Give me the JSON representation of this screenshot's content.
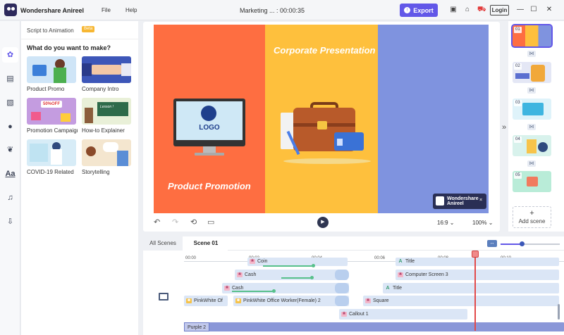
{
  "app": {
    "title": "Wondershare Anireel",
    "menu": [
      "File",
      "Help"
    ],
    "document_title": "Marketing ... : 00:00:35",
    "export_label": "Export",
    "login_label": "Login"
  },
  "left_panel": {
    "header": "Script to Animation",
    "header_badge": "Beta",
    "question": "What do you want to make?",
    "templates": [
      {
        "label": "Product Promo"
      },
      {
        "label": "Company Intro"
      },
      {
        "label": "Promotion Campaign"
      },
      {
        "label": "How-to Explainer"
      },
      {
        "label": "COVID-19 Related"
      },
      {
        "label": "Storytelling"
      }
    ],
    "thumb_texts": {
      "promo_ribbon": "50%OFF",
      "lesson": "Lesson !"
    }
  },
  "canvas": {
    "slide_text_1": "Corporate Presentation",
    "slide_text_2": "Product Promotion",
    "monitor_logo": "LOGO",
    "watermark_line1": "Wondershare",
    "watermark_line2": "Anireel",
    "watermark_close": "×",
    "aspect_ratio": "16:9",
    "zoom_level": "100%",
    "colors": {
      "orange": "#fe6e41",
      "yellow": "#fec03d",
      "blue": "#7f93df",
      "accent": "#6257e8"
    }
  },
  "scenes_panel": {
    "scenes": [
      {
        "num": "01"
      },
      {
        "num": "02"
      },
      {
        "num": "03"
      },
      {
        "num": "04"
      },
      {
        "num": "05"
      }
    ],
    "add_scene_label": "Add scene"
  },
  "timeline": {
    "tabs": [
      "All Scenes",
      "Scene 01"
    ],
    "ruler": [
      "00:00",
      "00:02",
      "00:04",
      "00:06",
      "00:08",
      "00:10"
    ],
    "clips": {
      "coin": "Coin",
      "title_top": "Title",
      "cash_1": "Cash",
      "computer_screen": "Computer Screen 3",
      "cash_2": "Cash",
      "title_2": "Title",
      "pink_white_short": "PinkWhite Of",
      "pink_white_long": "PinkWhite Office Worker(Female) 2",
      "square": "Square",
      "callout": "Callout 1",
      "purple": "Purple 2"
    }
  }
}
